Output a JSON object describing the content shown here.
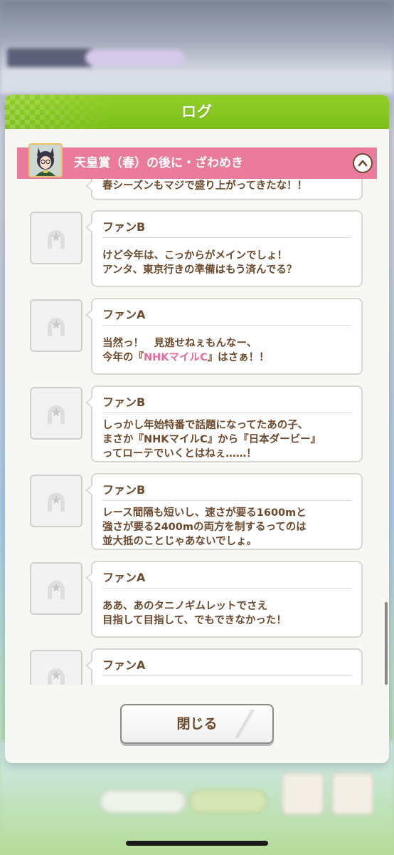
{
  "dialog": {
    "title": "ログ",
    "close_label": "閉じる"
  },
  "event": {
    "title": "天皇賞（春）の後に・ざわめき"
  },
  "messages": [
    {
      "speaker": "",
      "text": "春シーズンもマジで盛り上がってきたな！！"
    },
    {
      "speaker": "ファンB",
      "text": "けど今年は、こっからがメインでしょ！\nアンタ、東京行きの準備はもう済んでる？"
    },
    {
      "speaker": "ファンA",
      "text_before": "当然っ！　見逃せねぇもんなー、\n今年の『",
      "text_highlight": "NHKマイルC",
      "text_after": "』はさぁ！！",
      "highlight_color": "#e8699a"
    },
    {
      "speaker": "ファンB",
      "text": "しっかし年始特番で話題になってたあの子、\nまさか『NHKマイルC』から『日本ダービー』\nってローテでいくとはねぇ……！"
    },
    {
      "speaker": "ファンB",
      "text": "レース間隔も短いし、速さが要る1600mと\n強さが要る2400mの両方を制するってのは\n並大抵のことじゃあないでしょ。"
    },
    {
      "speaker": "ファンA",
      "text": "ああ、あのタニノギムレットでさえ\n目指して目指して、でもできなかった！"
    },
    {
      "speaker": "ファンA",
      "text": ""
    }
  ],
  "colors": {
    "header_green": "#7cc01a",
    "event_pink": "#ea7b9c",
    "text_brown": "#6b4a2e",
    "highlight_pink": "#e8699a"
  },
  "icons": {
    "collapse": "chevron-up-icon",
    "fan_avatar": "horseshoe-icon"
  }
}
